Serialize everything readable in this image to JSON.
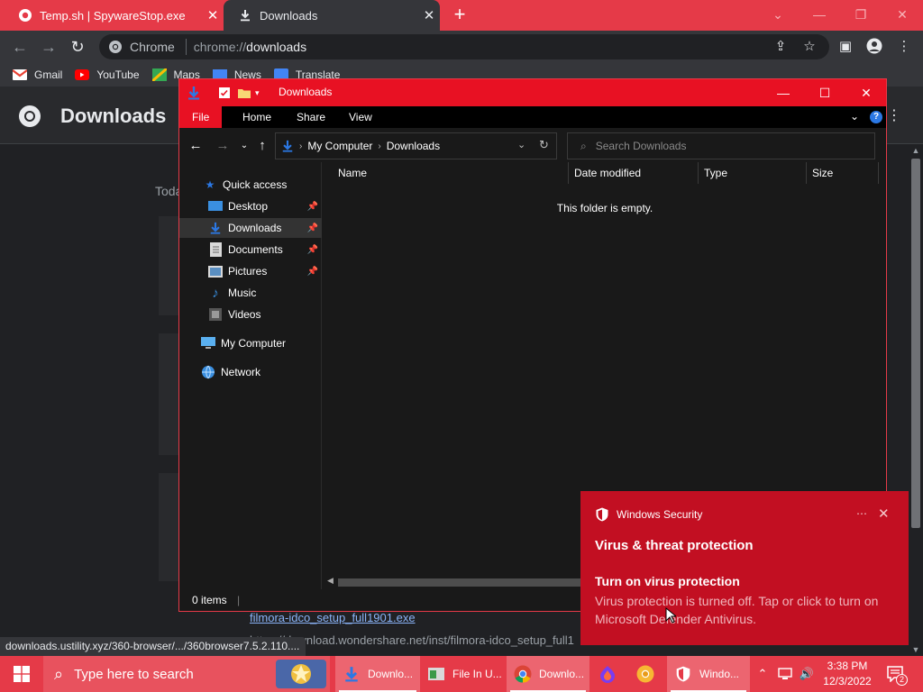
{
  "browser": {
    "tabs": [
      {
        "label": "Temp.sh | SpywareStop.exe",
        "active": false
      },
      {
        "label": "Downloads",
        "active": true
      }
    ],
    "omnibox": {
      "chip": "Chrome",
      "url_scheme": "chrome://",
      "url_path": "downloads"
    },
    "bookmarks": [
      "Gmail",
      "YouTube",
      "Maps",
      "News",
      "Translate"
    ],
    "accent_color": "#e53a48"
  },
  "downloads_page": {
    "title": "Downloads",
    "section_label": "Toda",
    "filmora_file": "filmora-idco_setup_full1901.exe",
    "filmora_url": "https://download.wondershare.net/inst/filmora-idco_setup_full1",
    "status_url": "downloads.ustility.xyz/360-browser/.../360browser7.5.2.110...."
  },
  "explorer": {
    "title": "Downloads",
    "ribbon_tabs": [
      "File",
      "Home",
      "Share",
      "View"
    ],
    "help_label": "?",
    "address": [
      "My Computer",
      "Downloads"
    ],
    "search_placeholder": "Search Downloads",
    "nav_pane": {
      "quick_access": "Quick access",
      "items": [
        {
          "label": "Desktop",
          "icon": "desktop-icon",
          "pinned": true
        },
        {
          "label": "Downloads",
          "icon": "downloads-folder-icon",
          "pinned": true,
          "selected": true
        },
        {
          "label": "Documents",
          "icon": "documents-icon",
          "pinned": true
        },
        {
          "label": "Pictures",
          "icon": "pictures-icon",
          "pinned": true
        },
        {
          "label": "Music",
          "icon": "music-icon",
          "pinned": false
        },
        {
          "label": "Videos",
          "icon": "videos-icon",
          "pinned": false
        }
      ],
      "my_computer": "My Computer",
      "network": "Network"
    },
    "columns": [
      "Name",
      "Date modified",
      "Type",
      "Size"
    ],
    "empty_message": "This folder is empty.",
    "status": "0 items"
  },
  "toast": {
    "app_name": "Windows Security",
    "heading": "Virus & threat protection",
    "subheading": "Turn on virus protection",
    "body": "Virus protection is turned off. Tap or click to turn on Microsoft Defender Antivirus.",
    "color": "#c20f22"
  },
  "taskbar": {
    "search_placeholder": "Type here to search",
    "apps": [
      {
        "label": "Downlo...",
        "icon": "download-arrow-icon",
        "active": true
      },
      {
        "label": "File In U...",
        "icon": "file-in-use-icon",
        "active": false
      },
      {
        "label": "Downlo...",
        "icon": "chrome-icon",
        "active": true
      },
      {
        "label": "",
        "icon": "firefox-nightly-icon",
        "active": false
      },
      {
        "label": "",
        "icon": "chrome-canary-icon",
        "active": false
      },
      {
        "label": "Windo...",
        "icon": "windows-security-icon",
        "active": true
      }
    ],
    "time": "3:38 PM",
    "date": "12/3/2022",
    "notification_count": "2"
  }
}
